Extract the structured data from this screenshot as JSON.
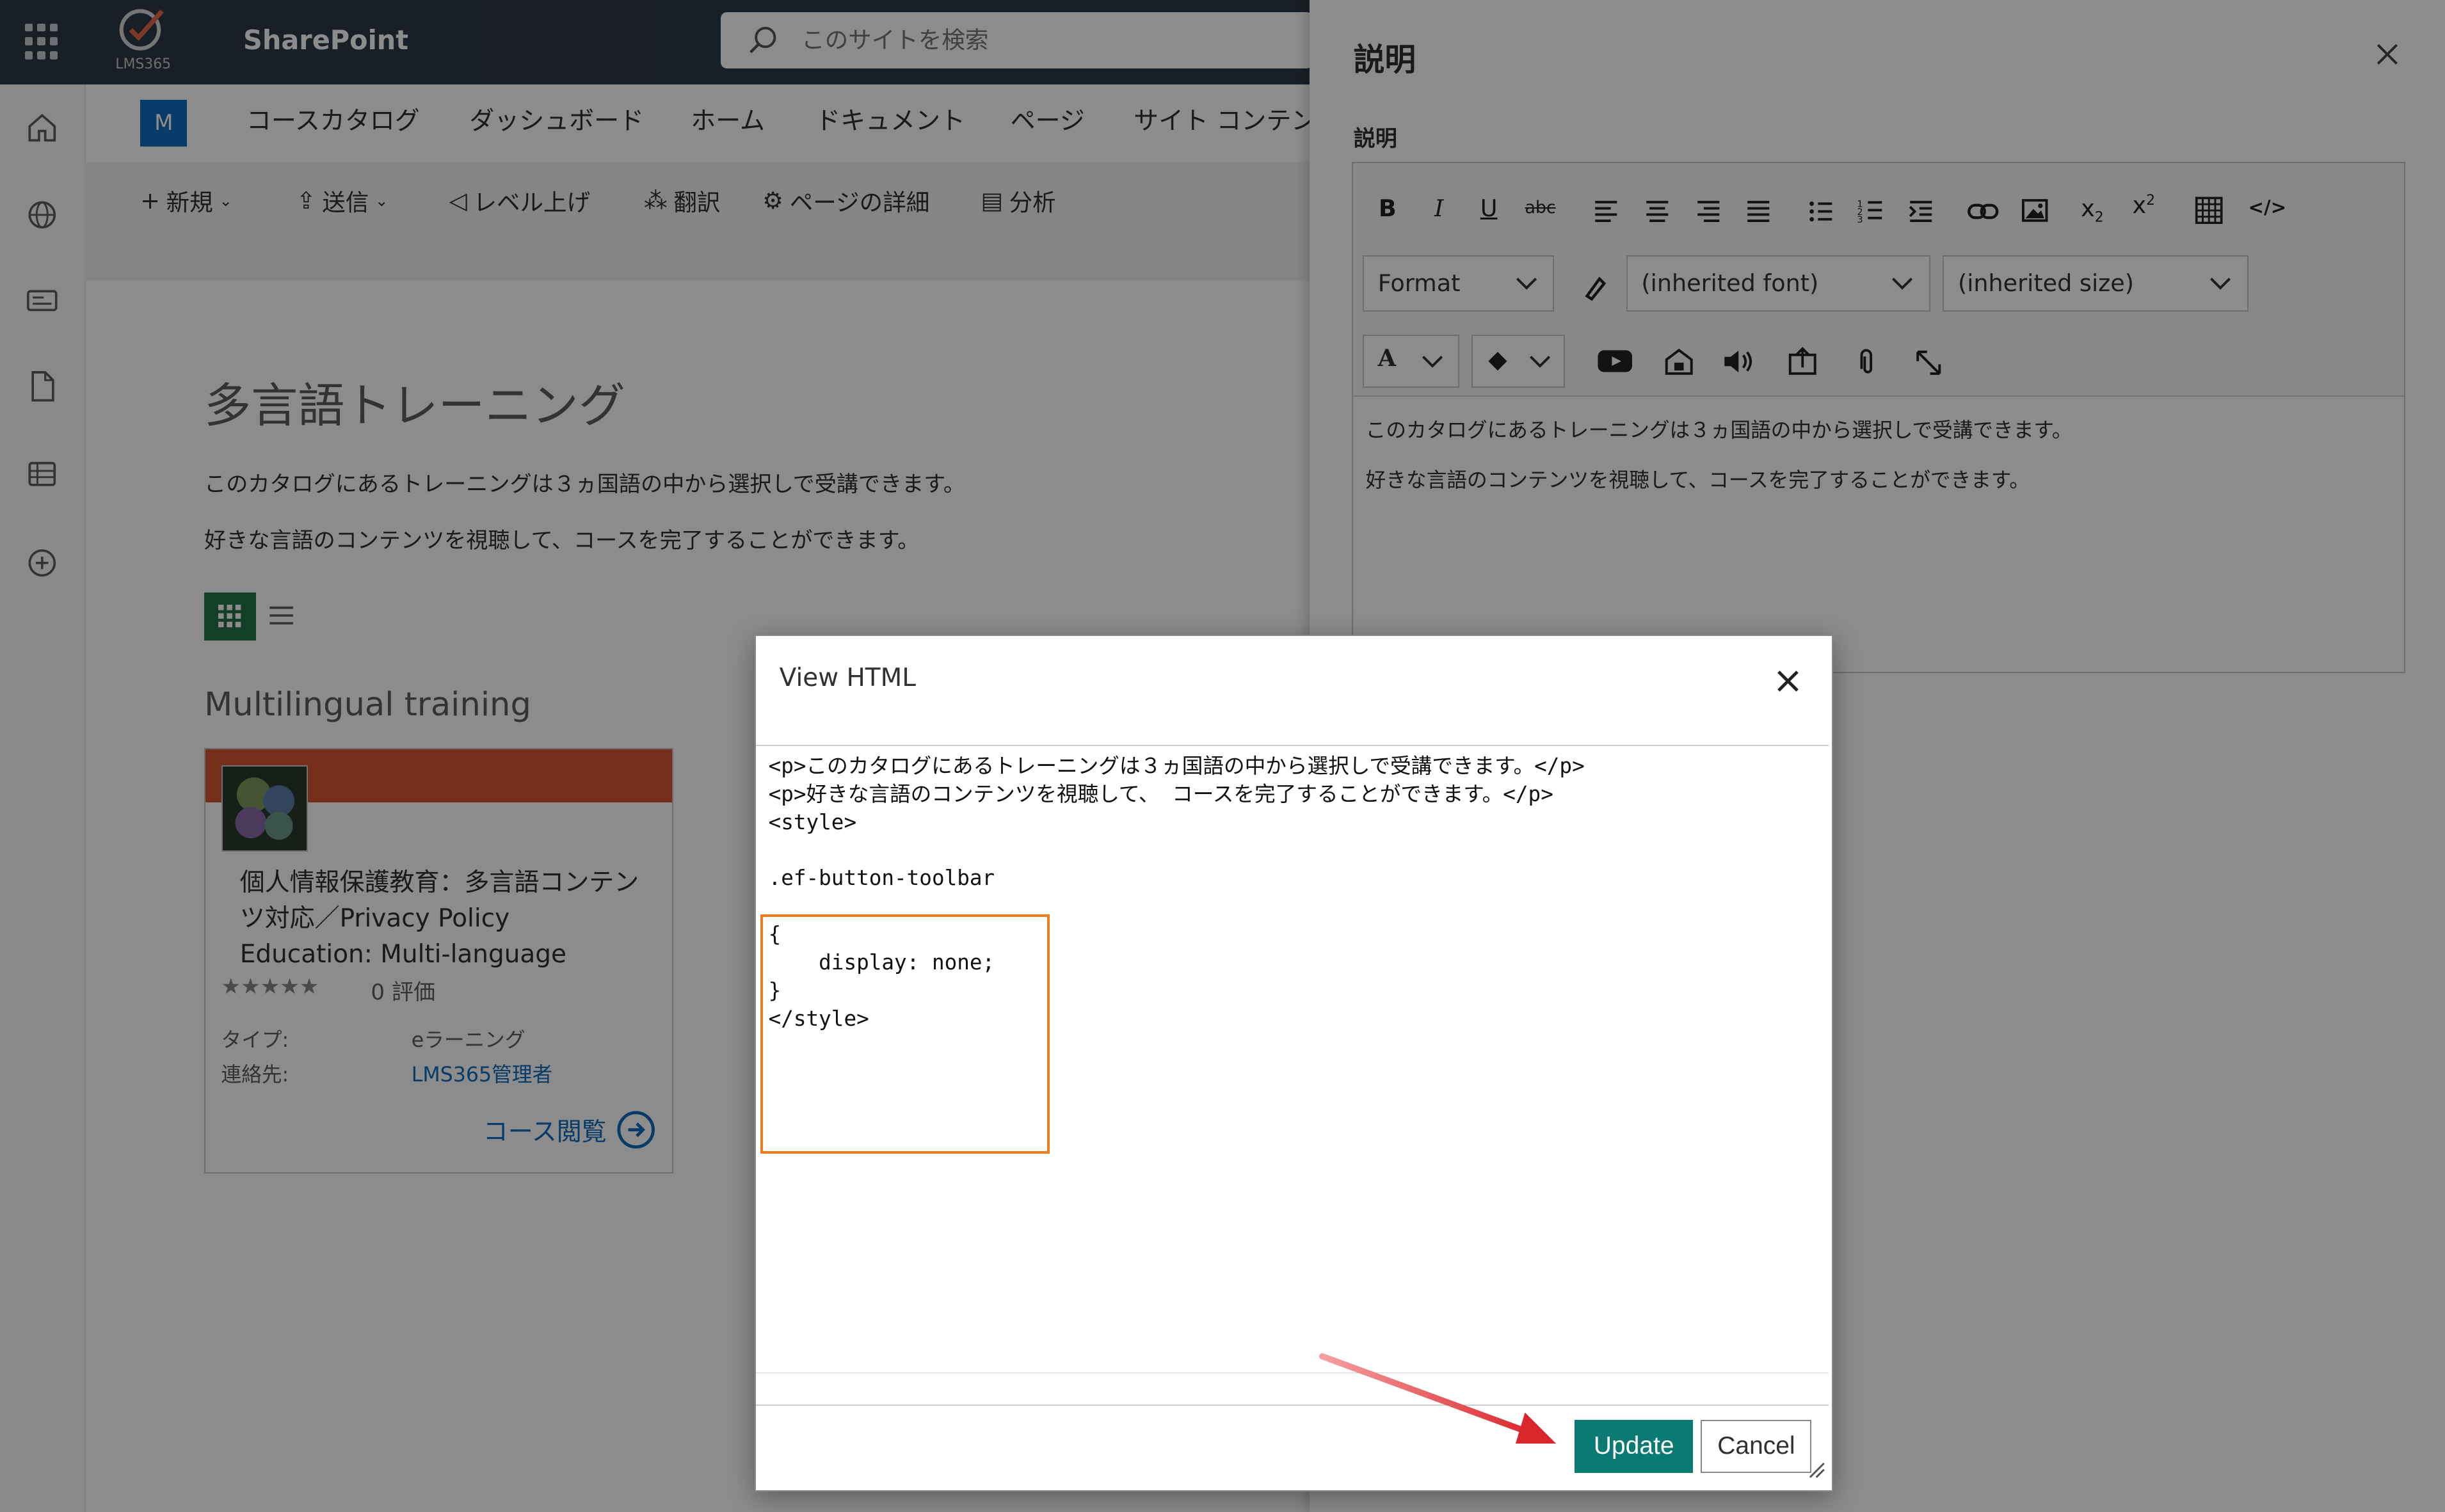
{
  "header": {
    "app_name": "SharePoint",
    "logo_text": "LMS365",
    "search_placeholder": "このサイトを検索"
  },
  "site": {
    "badge": "M",
    "nav": [
      "コースカタログ",
      "ダッシュボード",
      "ホーム",
      "ドキュメント",
      "ページ",
      "サイト コンテン"
    ]
  },
  "commands": [
    "新規",
    "送信",
    "レベル上げ",
    "翻訳",
    "ページの詳細",
    "分析"
  ],
  "page": {
    "title": "多言語トレーニング",
    "description_1": "このカタログにあるトレーニングは３ヵ国語の中から選択しで受講できます。",
    "description_2": "好きな言語のコンテンツを視聴して、コースを完了することができます。",
    "section_title": "Multilingual training"
  },
  "card": {
    "title": "個人情報保護教育：多言語コンテンツ対応／Privacy Policy Education: Multi-language",
    "stars": "★★★★★",
    "rating": "0 評価",
    "type_label": "タイプ:",
    "type_value": "eラーニング",
    "contact_label": "連絡先:",
    "contact_value": "LMS365管理者",
    "link": "コース閲覧"
  },
  "panel": {
    "title": "説明",
    "field_label": "説明",
    "format_select": "Format",
    "font_select": "(inherited font)",
    "size_select": "(inherited size)",
    "toolbar": {
      "bold": "B",
      "italic": "I",
      "underline": "U",
      "strike": "abc",
      "font_color": "A"
    },
    "content_line_1": "このカタログにあるトレーニングは３ヵ国語の中から選択しで受講できます。",
    "content_line_2": "好きな言語のコンテンツを視聴して、コースを完了することができます。"
  },
  "modal": {
    "title": "View HTML",
    "code_lines": [
      "<p>このカタログにあるトレーニングは３ヵ国語の中から選択しで受講できます。</p>",
      "<p>好きな言語のコンテンツを視聴して、 コースを完了することができます。</p>",
      "<style>",
      "",
      ".ef-button-toolbar",
      "",
      "{",
      "    display: none;",
      "}",
      "</style>"
    ],
    "update_label": "Update",
    "cancel_label": "Cancel"
  },
  "colors": {
    "header_bg": "#2f3a45",
    "accent_green": "#217346",
    "update_button": "#0a7a73",
    "highlight_border": "#f07c20",
    "annotation_arrow": "#d9262b"
  }
}
